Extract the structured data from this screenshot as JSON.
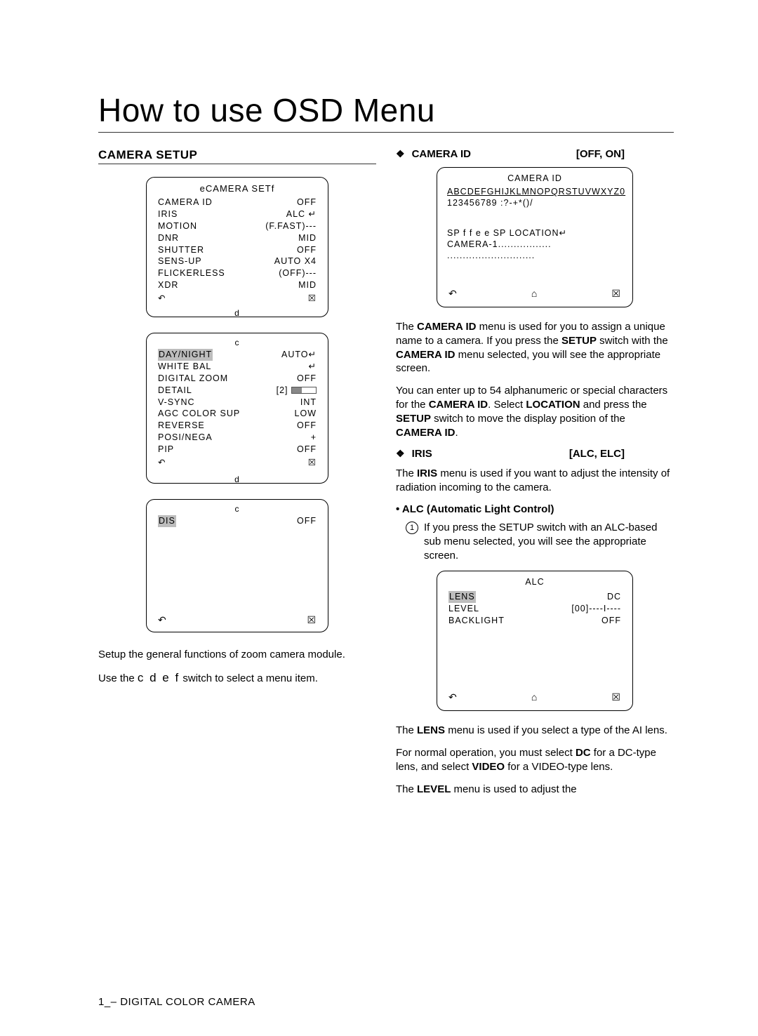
{
  "page": {
    "title": "How to use OSD Menu",
    "footer": "1_– DIGITAL COLOR CAMERA"
  },
  "left": {
    "heading": "CAMERA SETUP",
    "box1": {
      "title": "eCAMERA SETf",
      "rows": [
        {
          "l": "CAMERA ID",
          "r": "OFF"
        },
        {
          "l": "IRIS",
          "r": "ALC ↵"
        },
        {
          "l": "MOTION",
          "r": "(F.FAST)---"
        },
        {
          "l": "DNR",
          "r": "MID"
        },
        {
          "l": "SHUTTER",
          "r": "OFF"
        },
        {
          "l": "SENS-UP",
          "r": "AUTO X4"
        },
        {
          "l": "FLICKERLESS",
          "r": "(OFF)---"
        },
        {
          "l": "XDR",
          "r": "MID"
        }
      ],
      "back": "↶",
      "close": "☒",
      "down": "d"
    },
    "box2": {
      "top": "c",
      "rows": [
        {
          "l": "DAY/NIGHT",
          "r": "AUTO↵",
          "hl": true
        },
        {
          "l": "WHITE BAL",
          "r": "↵"
        },
        {
          "l": "DIGITAL ZOOM",
          "r": "OFF"
        },
        {
          "l": "DETAIL",
          "r": "[2]  BAR"
        },
        {
          "l": "V-SYNC",
          "r": "INT"
        },
        {
          "l": "AGC COLOR SUP",
          "r": "LOW"
        },
        {
          "l": "REVERSE",
          "r": "OFF"
        },
        {
          "l": "POSI/NEGA",
          "r": "+"
        },
        {
          "l": "PIP",
          "r": "OFF"
        }
      ],
      "back": "↶",
      "close": "☒",
      "down": "d"
    },
    "box3": {
      "top": "c",
      "rows": [
        {
          "l": "DIS",
          "r": "OFF",
          "hl": true
        }
      ],
      "back": "↶",
      "close": "☒"
    },
    "para1": "Setup the general functions of zoom camera module.",
    "para2_pre": "Use the ",
    "para2_keys": "c d e f",
    "para2_post": "  switch to select a menu item."
  },
  "right": {
    "cameraId": {
      "label": "CAMERA ID",
      "opts": "[OFF, ON]",
      "box": {
        "title": "CAMERA ID",
        "line1": "ABCDEFGHIJKLMNOPQRSTUVWXYZ0",
        "line2": "123456789 :?-+*()/",
        "line3": "SP f f e e  SP LOCATION↵",
        "line4": "CAMERA-1.................",
        "line5": "............................",
        "back": "↶",
        "home": "⌂",
        "close": "☒"
      },
      "p1_a": "The ",
      "p1_b": "CAMERA ID",
      "p1_c": " menu is used for you to assign a unique name to a camera. If you press the ",
      "p1_d": "SETUP",
      "p1_e": " switch with the ",
      "p1_f": "CAMERA ID",
      "p1_g": " menu selected, you will see the appropriate screen.",
      "p2_a": "You can enter up to 54 alphanumeric or special characters for the ",
      "p2_b": "CAMERA ID",
      "p2_c": ". Select ",
      "p2_d": "LOCATION",
      "p2_e": " and press the ",
      "p2_f": "SETUP",
      "p2_g": " switch to move the display position of the ",
      "p2_h": "CAMERA ID",
      "p2_i": "."
    },
    "iris": {
      "label": "IRIS",
      "opts": "[ALC, ELC]",
      "p1_a": "The ",
      "p1_b": "IRIS",
      "p1_c": " menu is used if you want to adjust the intensity of radiation incoming to the camera.",
      "alcHead": "ALC (Automatic Light Control)",
      "step1_a": "If you press the ",
      "step1_b": "SETUP",
      "step1_c": " switch with an ",
      "step1_d": "ALC",
      "step1_e": "-based sub menu selected, you will see the appropriate screen.",
      "box": {
        "title": "ALC",
        "rows": [
          {
            "l": "LENS",
            "r": "DC",
            "hl": true
          },
          {
            "l": "LEVEL",
            "r": "[00]----I----"
          },
          {
            "l": "BACKLIGHT",
            "r": "OFF"
          }
        ],
        "back": "↶",
        "home": "⌂",
        "close": "☒"
      },
      "p2_a": "The ",
      "p2_b": "LENS",
      "p2_c": " menu is used if you select a type of the AI lens.",
      "p3_a": "For normal operation, you must select ",
      "p3_b": "DC",
      "p3_c": " for a DC-type lens, and select ",
      "p3_d": "VIDEO",
      "p3_e": " for a VIDEO-type lens.",
      "p4_a": "The ",
      "p4_b": "LEVEL",
      "p4_c": " menu is used to adjust the"
    }
  }
}
